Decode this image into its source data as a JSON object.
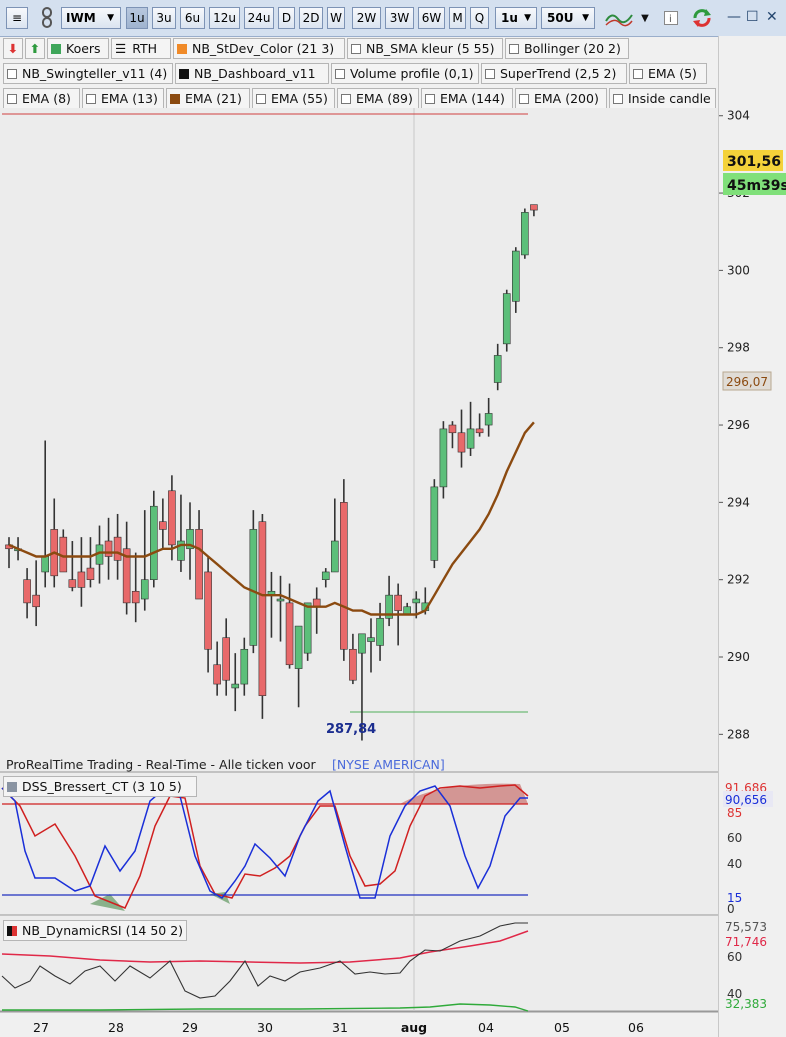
{
  "toolbar": {
    "symbol": "IWM",
    "timeframes": [
      "1u",
      "3u",
      "6u",
      "12u",
      "24u",
      "D",
      "2D",
      "W",
      "2W",
      "3W",
      "6W",
      "M",
      "Q"
    ],
    "active_timeframe": "1u",
    "interval_select": "1u",
    "units_select": "50U"
  },
  "row1": [
    {
      "label": "Koers",
      "swatch": "#3ea65a"
    },
    {
      "label": "RTH",
      "icon": "list"
    },
    {
      "label": "NB_StDev_Color (21 3)",
      "swatch": "#f08a28"
    },
    {
      "label": "NB_SMA kleur (5 55)"
    },
    {
      "label": "Bollinger (20 2)"
    }
  ],
  "row2": [
    {
      "label": "NB_Swingteller_v11 (4)"
    },
    {
      "label": "NB_Dashboard_v11",
      "swatch": "#111111"
    },
    {
      "label": "Volume profile (0,1)"
    },
    {
      "label": "SuperTrend (2,5 2)"
    },
    {
      "label": "EMA (5)"
    }
  ],
  "row3": [
    {
      "label": "EMA (8)"
    },
    {
      "label": "EMA (13)"
    },
    {
      "label": "EMA (21)",
      "swatch": "#8b4a10"
    },
    {
      "label": "EMA (55)"
    },
    {
      "label": "EMA (89)"
    },
    {
      "label": "EMA (144)"
    },
    {
      "label": "EMA (200)"
    },
    {
      "label": "Inside candle"
    }
  ],
  "price_axis": {
    "ticks": [
      "304",
      "302",
      "300",
      "298",
      "296",
      "294",
      "292",
      "290",
      "288"
    ],
    "last_price": "301,56",
    "countdown": "45m39s",
    "ema_value": "296,07"
  },
  "low_label": "287,84",
  "source_label": "ProRealTime Trading - Real-Time - Alle ticken voor",
  "exchange_label": "[NYSE AMERICAN]",
  "dss": {
    "title": "DSS_Bressert_CT (3 10 5)",
    "ticks": [
      "85",
      "60",
      "40",
      "15",
      "0"
    ],
    "value_red": "91,686",
    "value_blue": "90,656"
  },
  "rsi": {
    "title": "NB_DynamicRSI (14 50 2)",
    "ticks": [
      "60",
      "40"
    ],
    "value_top": "75,573",
    "value_red": "71,746",
    "value_green": "32,383"
  },
  "dates": [
    "27",
    "28",
    "29",
    "30",
    "31",
    "aug",
    "04",
    "05",
    "06"
  ],
  "colors": {
    "up": "#5cbf7a",
    "down": "#e8696a",
    "ema": "#8b4a10",
    "toolbar": "#d4e0ef"
  },
  "chart_data": {
    "type": "candlestick",
    "y_min": 287,
    "y_max": 304.2,
    "candles": [
      [
        292.9,
        293.1,
        292.3,
        292.8
      ],
      [
        292.8,
        293.1,
        292.5,
        292.8
      ],
      [
        292.0,
        292.3,
        291.0,
        291.4
      ],
      [
        291.6,
        292.5,
        290.8,
        291.3
      ],
      [
        292.2,
        295.6,
        291.8,
        292.6
      ],
      [
        293.3,
        294.1,
        291.8,
        292.1
      ],
      [
        293.1,
        293.3,
        292.2,
        292.2
      ],
      [
        292.0,
        293.0,
        291.7,
        291.8
      ],
      [
        292.2,
        293.1,
        291.3,
        291.8
      ],
      [
        292.3,
        293.1,
        291.8,
        292.0
      ],
      [
        292.4,
        293.4,
        291.9,
        292.9
      ],
      [
        293.0,
        293.6,
        292.0,
        292.6
      ],
      [
        293.1,
        293.7,
        292.0,
        292.5
      ],
      [
        292.8,
        293.5,
        291.1,
        291.4
      ],
      [
        291.7,
        292.7,
        290.9,
        291.4
      ],
      [
        291.5,
        293.8,
        291.2,
        292.0
      ],
      [
        292.0,
        294.3,
        291.8,
        293.9
      ],
      [
        293.5,
        294.1,
        292.8,
        293.3
      ],
      [
        294.3,
        294.7,
        292.5,
        292.9
      ],
      [
        292.5,
        294.2,
        292.2,
        293.0
      ],
      [
        292.8,
        294.0,
        292.0,
        293.3
      ],
      [
        293.3,
        293.8,
        291.8,
        291.5
      ],
      [
        292.2,
        292.6,
        289.6,
        290.2
      ],
      [
        289.8,
        290.4,
        289.0,
        289.3
      ],
      [
        290.5,
        291.0,
        289.0,
        289.4
      ],
      [
        289.2,
        290.1,
        288.6,
        289.3
      ],
      [
        289.3,
        290.5,
        289.0,
        290.2
      ],
      [
        290.3,
        293.8,
        290.1,
        293.3
      ],
      [
        293.5,
        293.7,
        288.4,
        289.0
      ],
      [
        291.6,
        292.2,
        290.5,
        291.7
      ],
      [
        291.5,
        292.1,
        290.4,
        291.5
      ],
      [
        291.4,
        291.9,
        289.7,
        289.8
      ],
      [
        289.7,
        290.6,
        288.7,
        290.8
      ],
      [
        290.1,
        291.2,
        289.9,
        291.4
      ],
      [
        291.5,
        291.8,
        290.6,
        291.3
      ],
      [
        292.0,
        292.3,
        291.8,
        292.2
      ],
      [
        292.2,
        294.1,
        292.6,
        293.0
      ],
      [
        294.0,
        294.6,
        289.9,
        290.2
      ],
      [
        290.2,
        290.6,
        289.3,
        289.4
      ],
      [
        290.1,
        290.3,
        287.84,
        290.6
      ],
      [
        290.4,
        291.0,
        289.6,
        290.5
      ],
      [
        290.3,
        291.4,
        289.9,
        291.0
      ],
      [
        291.0,
        292.1,
        290.8,
        291.6
      ],
      [
        291.6,
        291.9,
        290.3,
        291.2
      ],
      [
        291.1,
        291.4,
        291.2,
        291.3
      ],
      [
        291.4,
        291.7,
        291.0,
        291.5
      ],
      [
        291.2,
        291.8,
        291.1,
        291.4
      ],
      [
        292.5,
        294.6,
        292.3,
        294.4
      ],
      [
        294.4,
        296.1,
        294.1,
        295.9
      ],
      [
        296.0,
        296.1,
        295.4,
        295.8
      ],
      [
        295.8,
        296.4,
        294.9,
        295.3
      ],
      [
        295.4,
        296.6,
        295.2,
        295.9
      ],
      [
        295.9,
        296.3,
        295.7,
        295.8
      ],
      [
        296.0,
        296.7,
        295.7,
        296.3
      ],
      [
        297.1,
        298.1,
        296.9,
        297.8
      ],
      [
        298.1,
        299.5,
        297.9,
        299.4
      ],
      [
        299.2,
        300.6,
        298.9,
        300.5
      ],
      [
        300.4,
        301.6,
        300.3,
        301.5
      ],
      [
        301.7,
        301.7,
        301.4,
        301.56
      ]
    ],
    "ema21": [
      292.9,
      292.8,
      292.7,
      292.6,
      292.6,
      292.7,
      292.6,
      292.6,
      292.6,
      292.6,
      292.7,
      292.7,
      292.7,
      292.6,
      292.6,
      292.6,
      292.7,
      292.8,
      292.8,
      292.9,
      292.9,
      292.8,
      292.6,
      292.4,
      292.2,
      292.0,
      291.8,
      291.7,
      291.6,
      291.6,
      291.6,
      291.5,
      291.4,
      291.3,
      291.3,
      291.3,
      291.4,
      291.3,
      291.2,
      291.2,
      291.1,
      291.1,
      291.1,
      291.1,
      291.1,
      291.1,
      291.2,
      291.6,
      292.0,
      292.4,
      292.7,
      293.0,
      293.3,
      293.7,
      294.2,
      294.8,
      295.3,
      295.8,
      296.07
    ]
  }
}
